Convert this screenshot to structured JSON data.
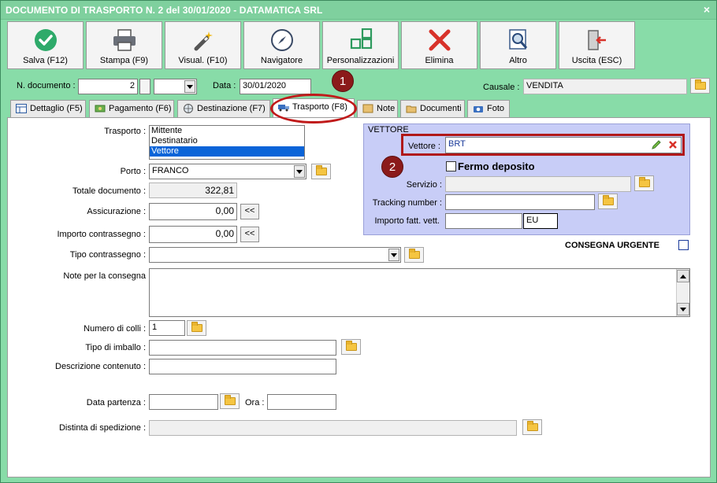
{
  "window": {
    "title": "DOCUMENTO DI TRASPORTO N. 2 del 30/01/2020 - DATAMATICA SRL",
    "close_glyph": "×"
  },
  "toolbar": [
    {
      "label": "Salva (F12)",
      "icon": "check-circle-icon"
    },
    {
      "label": "Stampa (F9)",
      "icon": "printer-icon"
    },
    {
      "label": "Visual. (F10)",
      "icon": "magic-wand-icon"
    },
    {
      "label": "Navigatore",
      "icon": "compass-icon"
    },
    {
      "label": "Personalizzazioni",
      "icon": "grid-squares-icon"
    },
    {
      "label": "Elimina",
      "icon": "red-x-icon"
    },
    {
      "label": "Altro",
      "icon": "magnifier-document-icon"
    },
    {
      "label": "Uscita (ESC)",
      "icon": "exit-door-icon"
    }
  ],
  "header": {
    "ndoc_label": "N. documento :",
    "ndoc_value": "2",
    "ndoc_suffix": "",
    "data_label": "Data :",
    "data_value": "30/01/2020",
    "causale_label": "Causale :",
    "causale_value": "VENDITA"
  },
  "tabs": [
    {
      "label": "Dettaglio (F5)",
      "icon": "table-icon"
    },
    {
      "label": "Pagamento (F6)",
      "icon": "money-icon"
    },
    {
      "label": "Destinazione (F7)",
      "icon": "globe-icon"
    },
    {
      "label": "Trasporto (F8)",
      "icon": "truck-icon",
      "active": true
    },
    {
      "label": "Note",
      "icon": "note-icon"
    },
    {
      "label": "Documenti",
      "icon": "folder-icon"
    },
    {
      "label": "Foto",
      "icon": "camera-icon"
    }
  ],
  "form": {
    "trasporto_label": "Trasporto :",
    "trasporto_options": [
      "Mittente",
      "Destinatario",
      "Vettore"
    ],
    "trasporto_selected": "Vettore",
    "porto_label": "Porto :",
    "porto_value": "FRANCO",
    "totale_label": "Totale documento :",
    "totale_value": "322,81",
    "assicurazione_label": "Assicurazione :",
    "assicurazione_value": "0,00",
    "contrassegno_label": "Importo contrassegno :",
    "contrassegno_value": "0,00",
    "back_button": "<<",
    "tipo_contrassegno_label": "Tipo contrassegno :",
    "tipo_contrassegno_value": "",
    "note_label": "Note per la consegna",
    "note_value": "",
    "colli_label": "Numero di colli :",
    "colli_value": "1",
    "imballo_label": "Tipo di imballo :",
    "imballo_value": "",
    "descrizione_label": "Descrizione contenuto :",
    "descrizione_value": "",
    "partenza_label": "Data partenza :",
    "partenza_value": "",
    "ora_label": "Ora :",
    "ora_value": "",
    "distinta_label": "Distinta di spedizione :",
    "distinta_value": ""
  },
  "vettore": {
    "group_title": "VETTORE",
    "vettore_label": "Vettore :",
    "vettore_value": "BRT",
    "fermo_label": "Fermo deposito",
    "servizio_label": "Servizio :",
    "servizio_value": "",
    "tracking_label": "Tracking number :",
    "tracking_value": "",
    "importo_label": "Importo fatt. vett.",
    "importo_value": "",
    "currency": "EU"
  },
  "urgente_label": "CONSEGNA URGENTE",
  "annotations": {
    "badge1": "1",
    "badge2": "2"
  },
  "colors": {
    "window_green": "#88dca8",
    "selection_blue": "#0a64d8",
    "vettore_group": "#c8cdf7",
    "annotation_red": "#b01818"
  }
}
